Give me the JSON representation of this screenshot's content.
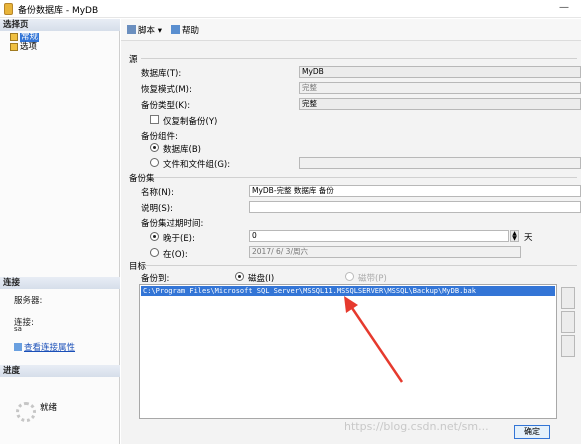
{
  "window": {
    "title": "备份数据库 - MyDB",
    "minimize_glyph": "—"
  },
  "left_pane": {
    "select_page_header": "选择页",
    "pages": [
      {
        "label": "常规",
        "selected": true
      },
      {
        "label": "选项",
        "selected": false
      }
    ],
    "connection_header": "连接",
    "server_label": "服务器:",
    "connection_label": "连接:",
    "connection_value": "sa",
    "view_connection_properties": "查看连接属性",
    "progress_header": "进度",
    "progress_status": "就绪"
  },
  "toolbar": {
    "script_label": "脚本",
    "help_label": "帮助"
  },
  "source": {
    "header": "源",
    "database_label": "数据库(T):",
    "database_value": "MyDB",
    "recovery_model_label": "恢复模式(M):",
    "recovery_model_value": "完整",
    "backup_type_label": "备份类型(K):",
    "backup_type_value": "完整",
    "copy_only_label": "仅复制备份(Y)",
    "backup_component_label": "备份组件:",
    "component_database_label": "数据库(B)",
    "component_files_label": "文件和文件组(G):"
  },
  "backup_set": {
    "header": "备份集",
    "name_label": "名称(N):",
    "name_value": "MyDB-完整 数据库 备份",
    "description_label": "说明(S):",
    "description_value": "",
    "expire_label": "备份集过期时间:",
    "after_label": "晚于(E):",
    "after_value": "0",
    "days_label": "天",
    "on_label": "在(O):",
    "on_value": "2017/ 6/ 3/周六"
  },
  "destination": {
    "header": "目标",
    "backup_to_label": "备份到:",
    "disk_label": "磁盘(I)",
    "tape_label": "磁带(P)",
    "paths": [
      "C:\\Program Files\\Microsoft SQL Server\\MSSQL11.MSSQLSERVER\\MSSQL\\Backup\\MyDB.bak"
    ]
  },
  "watermark": "https://blog.csdn.net/sm...",
  "ok_button": "确定"
}
